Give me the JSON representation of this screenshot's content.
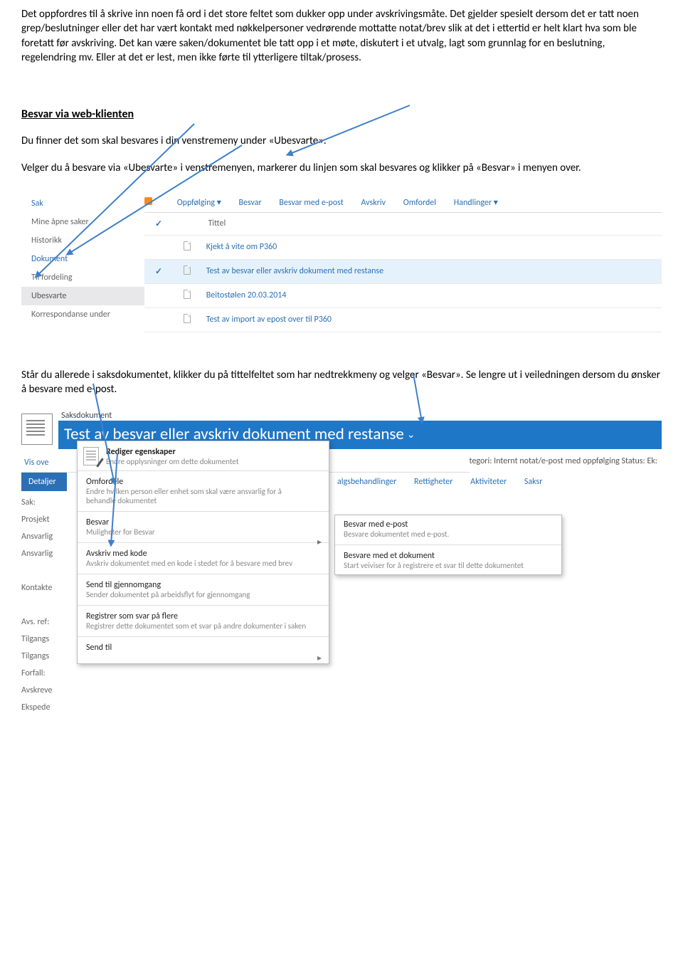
{
  "para1": "Det oppfordres til å skrive inn noen få ord i det store feltet som dukker opp under avskrivingsmåte. Det gjelder spesielt dersom det er tatt noen grep/beslutninger eller det har vært kontakt med nøkkelpersoner vedrørende mottatte notat/brev slik at det i ettertid er helt klart hva som ble foretatt før avskriving. Det kan være saken/dokumentet ble tatt opp i et møte, diskutert i et utvalg, lagt som grunnlag for en beslutning, regelendring mv. Eller at det er lest, men ikke førte til ytterligere tiltak/prosess.",
  "heading1": "Besvar via web-klienten",
  "para2": "Du finner det som skal besvares i din venstremeny under «Ubesvarte».",
  "para3": "Velger du å besvare via «Ubesvarte» i venstremenyen, markerer du linjen som skal besvares og klikker på «Besvar» i menyen over.",
  "para4": "Står du allerede i saksdokumentet, klikker du på tittelfeltet som har nedtrekkmeny og velger «Besvar». Se lengre ut i veiledningen dersom du ønsker å besvare med e-post.",
  "s1": {
    "sideh": "Sak",
    "side": [
      "Mine åpne saker",
      "Historikk",
      "Dokument",
      "Til fordeling",
      "Ubesvarte",
      "Korrespondanse under"
    ],
    "menu": [
      "Oppfølging ▾",
      "Besvar",
      "Besvar med e-post",
      "Avskriv",
      "Omfordel",
      "Handlinger ▾"
    ],
    "col": "Tittel",
    "rows": [
      "Kjekt å vite om P360",
      "Test av besvar eller avskriv dokument med restanse",
      "Beitostølen 20.03.2014",
      "Test av import av epost over til P360"
    ]
  },
  "s2": {
    "small": "Saksdokument",
    "title": "Test av besvar eller avskriv dokument med restanse",
    "leftlabel": "Vis ove",
    "bluetab": "Detaljer",
    "meta1": "tegori: Internt notat/e-post med oppfølging   Status: Ek:",
    "tabs": [
      "algsbehandlinger",
      "Rettigheter",
      "Aktiviteter",
      "Saksr"
    ],
    "labels": [
      "Sak:",
      "Prosjekt",
      "Ansvarlig",
      "Ansvarlig",
      "",
      "Kontakte",
      "",
      "Avs. ref:",
      "Tilgangs",
      "Tilgangs",
      "Forfall:",
      "Avskreve",
      "Ekspede"
    ],
    "m1": {
      "head_t": "Rediger egenskaper",
      "head_s": "Endre opplysninger om dette dokumentet",
      "items": [
        {
          "t": "Omfordele",
          "s": "Endre hvilken person eller enhet som skal være ansvarlig for å behandle dokumentet"
        },
        {
          "t": "Besvar",
          "s": "Muligheter for Besvar",
          "ar": true
        },
        {
          "t": "Avskriv med kode",
          "s": "Avskriv dokumentet med en kode i stedet for å besvare med brev"
        },
        {
          "t": "Send til gjennomgang",
          "s": "Sender dokumentet på arbeidsflyt for gjennomgang"
        },
        {
          "t": "Registrer som svar på flere",
          "s": "Registrer dette dokumentet som et svar på andre dokumenter i saken"
        },
        {
          "t": "Send til",
          "ar": true
        }
      ]
    },
    "m2": {
      "items": [
        {
          "t": "Besvar med e-post",
          "s": "Besvare dokumentet med e-post."
        },
        {
          "t": "Besvare med et dokument",
          "s": "Start veiviser for å registrere et svar til dette dokumentet"
        }
      ]
    }
  }
}
